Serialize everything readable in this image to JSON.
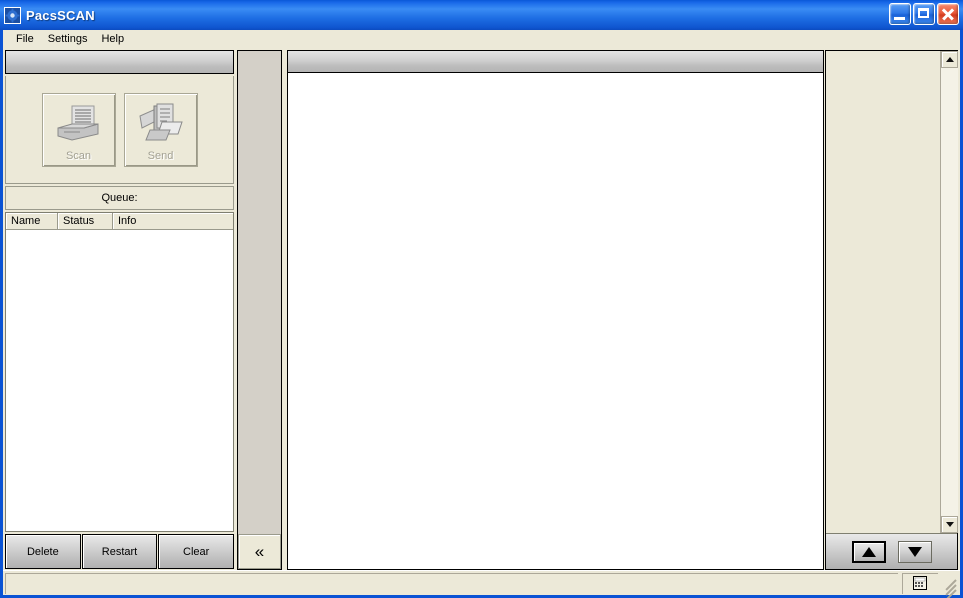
{
  "window": {
    "title": "PacsSCAN",
    "app_icon": "gear-disc-icon",
    "controls": {
      "minimize": "minimize-icon",
      "maximize": "maximize-icon",
      "close": "close-icon"
    }
  },
  "menubar": {
    "items": [
      {
        "label": "File"
      },
      {
        "label": "Settings"
      },
      {
        "label": "Help"
      }
    ]
  },
  "left_panel": {
    "toolbar": {
      "buttons": [
        {
          "label": "Scan",
          "icon": "scanner-icon",
          "enabled": false
        },
        {
          "label": "Send",
          "icon": "send-documents-icon",
          "enabled": false
        }
      ]
    },
    "queue_label": "Queue:",
    "queue_list": {
      "columns": [
        {
          "label": "Name"
        },
        {
          "label": "Status"
        },
        {
          "label": "Info"
        }
      ],
      "rows": []
    },
    "actions": [
      {
        "label": "Delete"
      },
      {
        "label": "Restart"
      },
      {
        "label": "Clear"
      }
    ]
  },
  "splitter": {
    "collapse_label": "«",
    "collapse_icon": "double-chevron-left-icon"
  },
  "center_panel": {
    "header_title": "",
    "content": ""
  },
  "right_panel": {
    "scrollbar": {
      "up_icon": "scroll-up-arrow-icon",
      "down_icon": "scroll-down-arrow-icon"
    },
    "nav": [
      {
        "icon": "arrow-up-icon",
        "focused": true
      },
      {
        "icon": "arrow-down-icon",
        "focused": false
      }
    ]
  },
  "statusbar": {
    "message": "",
    "icon": "grid-icon",
    "grip": "resize-grip-icon"
  }
}
